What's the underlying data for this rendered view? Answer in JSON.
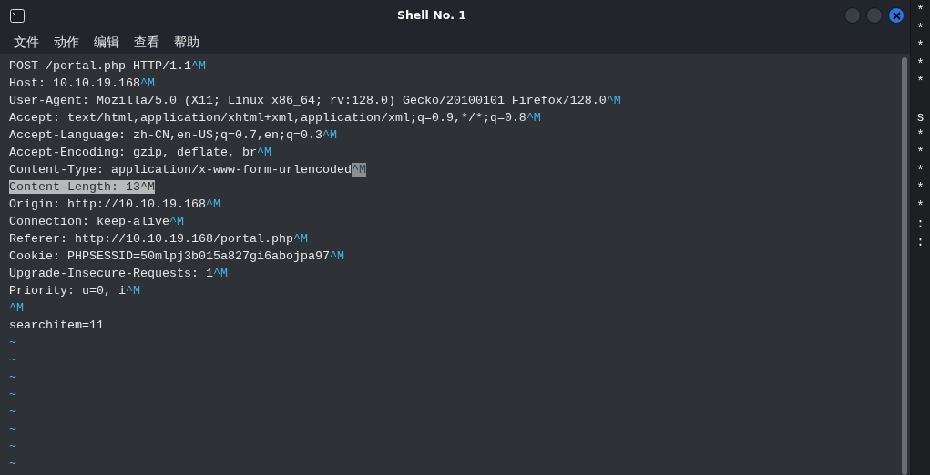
{
  "window": {
    "title": "Shell No. 1"
  },
  "menu": [
    {
      "label": "文件"
    },
    {
      "label": "动作"
    },
    {
      "label": "编辑"
    },
    {
      "label": "查看"
    },
    {
      "label": "帮助"
    }
  ],
  "lines": [
    {
      "selected": false,
      "segments": [
        {
          "kind": "text",
          "text": "POST /portal.php HTTP/1.1"
        },
        {
          "kind": "ctrl",
          "text": "^M"
        }
      ]
    },
    {
      "selected": false,
      "segments": [
        {
          "kind": "text",
          "text": "Host: 10.10.19.168"
        },
        {
          "kind": "ctrl",
          "text": "^M"
        }
      ]
    },
    {
      "selected": false,
      "segments": [
        {
          "kind": "text",
          "text": "User-Agent: Mozilla/5.0 (X11; Linux x86_64; rv:128.0) Gecko/20100101 Firefox/128.0"
        },
        {
          "kind": "ctrl",
          "text": "^M"
        }
      ]
    },
    {
      "selected": false,
      "segments": [
        {
          "kind": "text",
          "text": "Accept: text/html,application/xhtml+xml,application/xml;q=0.9,*/*;q=0.8"
        },
        {
          "kind": "ctrl",
          "text": "^M"
        }
      ]
    },
    {
      "selected": false,
      "segments": [
        {
          "kind": "text",
          "text": "Accept-Language: zh-CN,en-US;q=0.7,en;q=0.3"
        },
        {
          "kind": "ctrl",
          "text": "^M"
        }
      ]
    },
    {
      "selected": false,
      "segments": [
        {
          "kind": "text",
          "text": "Accept-Encoding: gzip, deflate, br"
        },
        {
          "kind": "ctrl",
          "text": "^M"
        }
      ]
    },
    {
      "selected": false,
      "segments": [
        {
          "kind": "text",
          "text": "Content-Type: application/x-www-form-urlencoded"
        },
        {
          "kind": "cursor",
          "text": "^M"
        }
      ]
    },
    {
      "selected": true,
      "segments": [
        {
          "kind": "text",
          "text": "Content-Length: 13^M"
        }
      ]
    },
    {
      "selected": false,
      "segments": [
        {
          "kind": "text",
          "text": "Origin: http://10.10.19.168"
        },
        {
          "kind": "ctrl",
          "text": "^M"
        }
      ]
    },
    {
      "selected": false,
      "segments": [
        {
          "kind": "text",
          "text": "Connection: keep-alive"
        },
        {
          "kind": "ctrl",
          "text": "^M"
        }
      ]
    },
    {
      "selected": false,
      "segments": [
        {
          "kind": "text",
          "text": "Referer: http://10.10.19.168/portal.php"
        },
        {
          "kind": "ctrl",
          "text": "^M"
        }
      ]
    },
    {
      "selected": false,
      "segments": [
        {
          "kind": "text",
          "text": "Cookie: PHPSESSID=50mlpj3b015a827gi6abojpa97"
        },
        {
          "kind": "ctrl",
          "text": "^M"
        }
      ]
    },
    {
      "selected": false,
      "segments": [
        {
          "kind": "text",
          "text": "Upgrade-Insecure-Requests: 1"
        },
        {
          "kind": "ctrl",
          "text": "^M"
        }
      ]
    },
    {
      "selected": false,
      "segments": [
        {
          "kind": "text",
          "text": "Priority: u=0, i"
        },
        {
          "kind": "ctrl",
          "text": "^M"
        }
      ]
    },
    {
      "selected": false,
      "segments": [
        {
          "kind": "ctrl",
          "text": "^M"
        }
      ]
    },
    {
      "selected": false,
      "segments": [
        {
          "kind": "text",
          "text": "searchitem=11"
        }
      ]
    },
    {
      "selected": false,
      "segments": [
        {
          "kind": "ctrl",
          "text": "~"
        }
      ]
    },
    {
      "selected": false,
      "segments": [
        {
          "kind": "ctrl",
          "text": "~"
        }
      ]
    },
    {
      "selected": false,
      "segments": [
        {
          "kind": "ctrl",
          "text": "~"
        }
      ]
    },
    {
      "selected": false,
      "segments": [
        {
          "kind": "ctrl",
          "text": "~"
        }
      ]
    },
    {
      "selected": false,
      "segments": [
        {
          "kind": "ctrl",
          "text": "~"
        }
      ]
    },
    {
      "selected": false,
      "segments": [
        {
          "kind": "ctrl",
          "text": "~"
        }
      ]
    },
    {
      "selected": false,
      "segments": [
        {
          "kind": "ctrl",
          "text": "~"
        }
      ]
    },
    {
      "selected": false,
      "segments": [
        {
          "kind": "ctrl",
          "text": "~"
        }
      ]
    }
  ],
  "background_strip": [
    {
      "kind": "char",
      "text": "*"
    },
    {
      "kind": "char",
      "text": "*"
    },
    {
      "kind": "char",
      "text": "*"
    },
    {
      "kind": "char",
      "text": "*"
    },
    {
      "kind": "char",
      "text": "*"
    },
    {
      "kind": "gap"
    },
    {
      "kind": "char",
      "text": "s"
    },
    {
      "kind": "char",
      "text": "*"
    },
    {
      "kind": "char",
      "text": "*"
    },
    {
      "kind": "char",
      "text": "*"
    },
    {
      "kind": "char",
      "text": "*"
    },
    {
      "kind": "char",
      "text": "*"
    },
    {
      "kind": "char",
      "text": ":"
    },
    {
      "kind": "char",
      "text": ":"
    }
  ]
}
